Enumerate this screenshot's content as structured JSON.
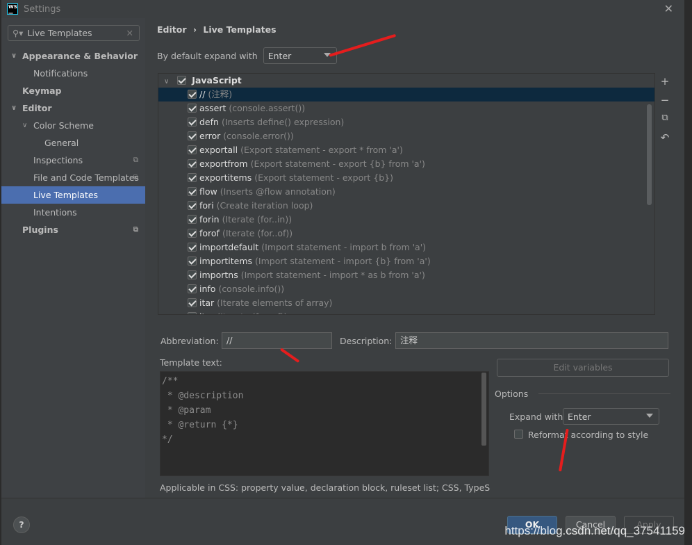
{
  "window": {
    "title": "Settings",
    "logo": "WS"
  },
  "search": {
    "value": "Live Templates"
  },
  "sidebar": {
    "items": [
      {
        "label": "Appearance & Behavior",
        "level": 0,
        "bold": true,
        "expanded": true
      },
      {
        "label": "Notifications",
        "level": 1
      },
      {
        "label": "Keymap",
        "level": 0,
        "bold": true
      },
      {
        "label": "Editor",
        "level": 0,
        "bold": true,
        "expanded": true
      },
      {
        "label": "Color Scheme",
        "level": 1,
        "expanded": true
      },
      {
        "label": "General",
        "level": 2
      },
      {
        "label": "Inspections",
        "level": 1,
        "copy": true
      },
      {
        "label": "File and Code Templates",
        "level": 1,
        "copy": true
      },
      {
        "label": "Live Templates",
        "level": 1,
        "selected": true
      },
      {
        "label": "Intentions",
        "level": 1
      },
      {
        "label": "Plugins",
        "level": 0,
        "bold": true,
        "copy": true
      }
    ]
  },
  "breadcrumb": {
    "parent": "Editor",
    "separator": "›",
    "current": "Live Templates"
  },
  "default_expand": {
    "label": "By default expand with",
    "value": "Enter"
  },
  "templates": {
    "group": "JavaScript",
    "items": [
      {
        "name": "//",
        "desc": "(注释)",
        "selected": true
      },
      {
        "name": "assert",
        "desc": "(console.assert())"
      },
      {
        "name": "defn",
        "desc": "(Inserts define() expression)"
      },
      {
        "name": "error",
        "desc": "(console.error())"
      },
      {
        "name": "exportall",
        "desc": "(Export statement - export * from 'a')"
      },
      {
        "name": "exportfrom",
        "desc": "(Export statement - export {b} from 'a')"
      },
      {
        "name": "exportitems",
        "desc": "(Export statement - export {b})"
      },
      {
        "name": "flow",
        "desc": "(Inserts @flow annotation)"
      },
      {
        "name": "fori",
        "desc": "(Create iteration loop)"
      },
      {
        "name": "forin",
        "desc": "(Iterate (for..in))"
      },
      {
        "name": "forof",
        "desc": "(Iterate (for..of))"
      },
      {
        "name": "importdefault",
        "desc": "(Import statement - import b from 'a')"
      },
      {
        "name": "importitems",
        "desc": "(Import statement - import {b} from 'a')"
      },
      {
        "name": "importns",
        "desc": "(Import statement - import * as b from 'a')"
      },
      {
        "name": "info",
        "desc": "(console.info())"
      },
      {
        "name": "itar",
        "desc": "(Iterate elements of array)"
      },
      {
        "name": "iter",
        "desc": "(Iterate (for..of))"
      }
    ]
  },
  "toolbar": {
    "add": "+",
    "remove": "−",
    "copy": "⧉",
    "revert": "↶"
  },
  "abbreviation": {
    "label": "Abbreviation:",
    "value": "//"
  },
  "description": {
    "label": "Description:",
    "value": "注释"
  },
  "template_text": {
    "label": "Template text:",
    "value": "/**\n * @description\n * @param\n * @return {*}\n*/"
  },
  "edit_variables": "Edit variables",
  "options": {
    "title": "Options",
    "expand_label": "Expand with",
    "expand_value": "Enter",
    "reformat_label": "Reformat according to style",
    "reformat_checked": false
  },
  "applicable": "Applicable in CSS: property value, declaration block, ruleset list; CSS, TypeScript; ",
  "buttons": {
    "help": "?",
    "ok": "OK",
    "cancel": "Cancel",
    "apply": "Apply"
  },
  "watermark": "https://blog.csdn.net/qq_37541159",
  "colors": {
    "selection": "#4b6eaf",
    "annotation_arrow": "#e51d1d",
    "ok": "#365880"
  }
}
